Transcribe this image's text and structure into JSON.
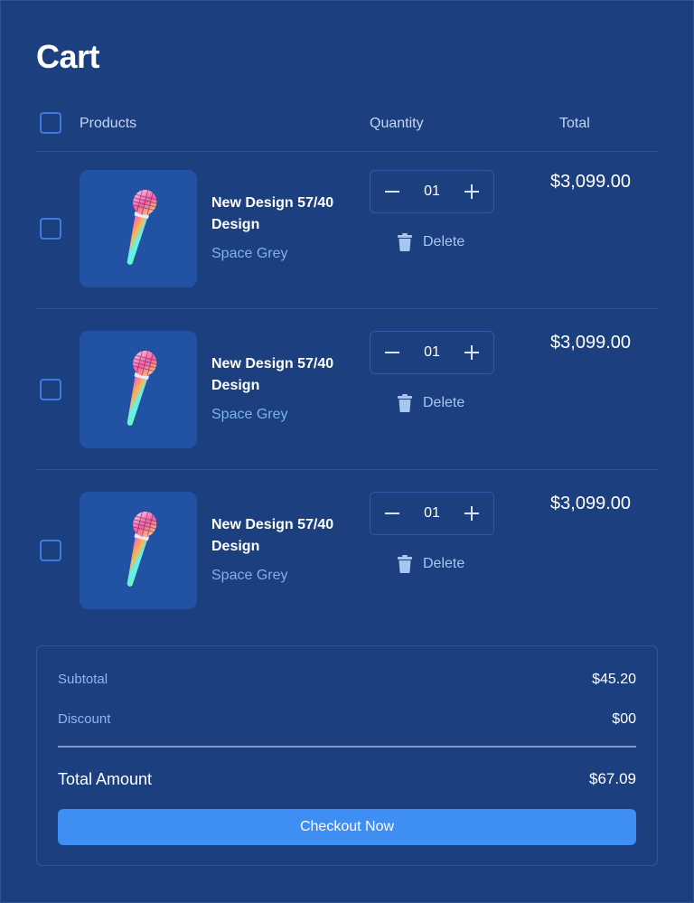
{
  "page": {
    "title": "Cart"
  },
  "header": {
    "products_label": "Products",
    "quantity_label": "Quantity",
    "total_label": "Total"
  },
  "items": [
    {
      "name": "New Design 57/40 Design",
      "variant": "Space Grey",
      "quantity": "01",
      "price": "$3,099.00",
      "delete_label": "Delete",
      "image_icon": "microphone-icon"
    },
    {
      "name": "New Design 57/40 Design",
      "variant": "Space Grey",
      "quantity": "01",
      "price": "$3,099.00",
      "delete_label": "Delete",
      "image_icon": "microphone-icon"
    },
    {
      "name": "New Design 57/40 Design",
      "variant": "Space Grey",
      "quantity": "01",
      "price": "$3,099.00",
      "delete_label": "Delete",
      "image_icon": "microphone-icon"
    }
  ],
  "summary": {
    "subtotal_label": "Subtotal",
    "subtotal_value": "$45.20",
    "discount_label": "Discount",
    "discount_value": "$00",
    "total_label": "Total Amount",
    "total_value": "$67.09",
    "checkout_label": "Checkout Now"
  },
  "colors": {
    "background": "#1b3f7f",
    "thumbnail_bg": "#2252a3",
    "checkbox_border": "#3f7ae0",
    "accent_button": "#3f8ef3",
    "variant_text": "#7fb0f3"
  }
}
